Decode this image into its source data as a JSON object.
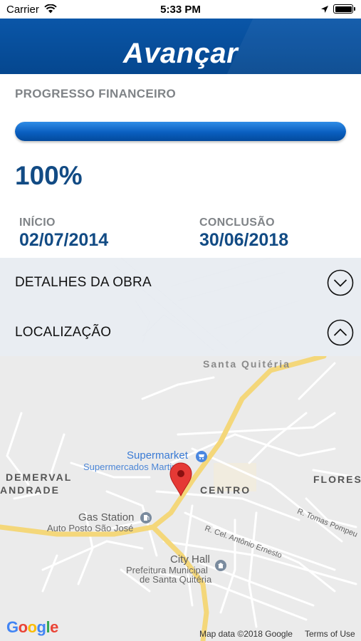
{
  "status_bar": {
    "carrier": "Carrier",
    "time": "5:33 PM"
  },
  "header": {
    "app_name": "Avançar",
    "brand_color": "#0a56a8"
  },
  "progress": {
    "section_title": "PROGRESSO FINANCEIRO",
    "fraction": 1.0,
    "percent_text": "100%",
    "start_label": "INÍCIO",
    "start_date": "02/07/2014",
    "end_label": "CONCLUSÃO",
    "end_date": "30/06/2018"
  },
  "accordions": {
    "details": {
      "label": "DETALHES DA OBRA",
      "state": "collapsed"
    },
    "location": {
      "label": "LOCALIZAÇÃO",
      "state": "expanded"
    }
  },
  "map": {
    "places": {
      "santa_quiteria": "Santa Quitéria",
      "demerval": "DEMERVAL",
      "andrade": "ANDRADE",
      "centro": "CENTRO",
      "flores": "FLORES"
    },
    "pois": {
      "supermarket": "Supermarket",
      "supermarket_sub": "Supermercados Martins",
      "gas": "Gas Station",
      "gas_sub": "Auto Posto São José",
      "city_hall": "City Hall",
      "city_hall_sub1": "Prefeitura Municipal",
      "city_hall_sub2": "de Santa Quitéria"
    },
    "streets": {
      "street1": "R. Cel. Antônio Ernesto",
      "street2": "R. Tomas Pompeu"
    },
    "google_logo": "Google",
    "attribution": "Map data ©2018 Google",
    "terms": "Terms of Use"
  }
}
